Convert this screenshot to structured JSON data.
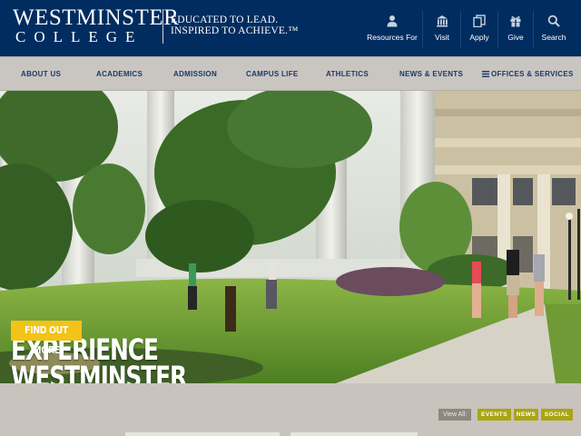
{
  "header": {
    "logo_top": "WESTMINSTER",
    "logo_bottom": "COLLEGE",
    "tagline_1": "EDUCATED TO LEAD.",
    "tagline_2": "INSPIRED TO ACHIEVE.™",
    "utility": [
      {
        "label": "Resources For",
        "icon": "person-icon"
      },
      {
        "label": "Visit",
        "icon": "building-icon"
      },
      {
        "label": "Apply",
        "icon": "document-icon"
      },
      {
        "label": "Give",
        "icon": "gift-icon"
      },
      {
        "label": "Search",
        "icon": "search-icon"
      }
    ]
  },
  "nav": {
    "items": [
      "ABOUT US",
      "ACADEMICS",
      "ADMISSION",
      "CAMPUS LIFE",
      "ATHLETICS",
      "NEWS & EVENTS",
      "OFFICES & SERVICES"
    ]
  },
  "hero": {
    "title_1": "EXPERIENCE",
    "title_2": "WESTMINSTER",
    "button": "FIND OUT MORE"
  },
  "lower": {
    "view_all": "View All:",
    "tags": [
      "EVENTS",
      "NEWS",
      "SOCIAL"
    ]
  },
  "colors": {
    "header": "#002c5f",
    "nav_text": "#1a3a66",
    "button": "#f2c318",
    "tag": "#a9a514"
  }
}
